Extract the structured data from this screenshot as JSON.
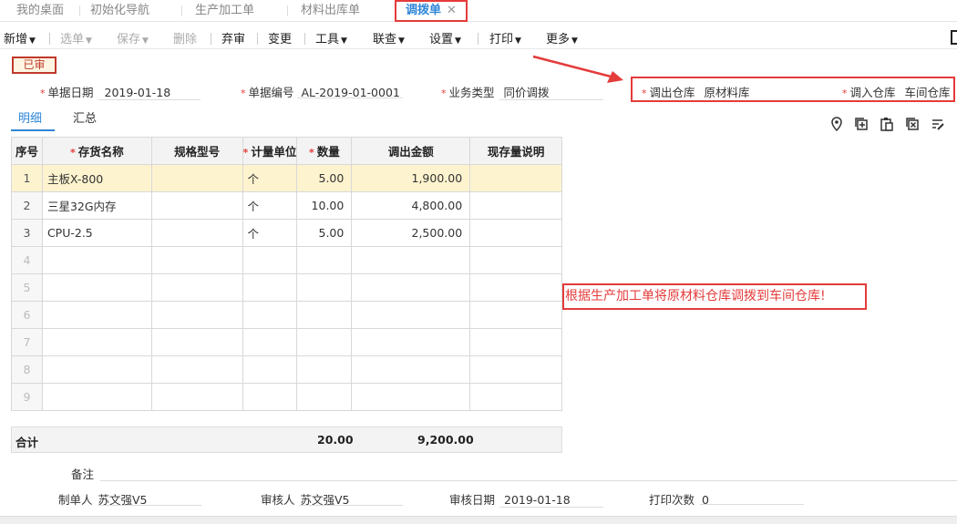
{
  "tabs": [
    "我的桌面",
    "初始化导航",
    "生产加工单",
    "材料出库单",
    "调拨单"
  ],
  "toolbar": {
    "new": "新增",
    "select": "选单",
    "save": "保存",
    "delete": "删除",
    "abandon": "弃审",
    "change": "变更",
    "tools": "工具",
    "link": "联查",
    "settings": "设置",
    "print": "打印",
    "more": "更多"
  },
  "status_stamp": "已审",
  "header": {
    "date_label": "单据日期",
    "date_value": "2019-01-18",
    "code_label": "单据编号",
    "code_value": "AL-2019-01-0001",
    "type_label": "业务类型",
    "type_value": "同价调拨",
    "out_wh_label": "调出仓库",
    "out_wh_value": "原材料库",
    "in_wh_label": "调入仓库",
    "in_wh_value": "车间仓库"
  },
  "subtabs": [
    "明细",
    "汇总"
  ],
  "icons": [
    "location-icon",
    "copy-add-icon",
    "paste-icon",
    "delete-row-icon",
    "edit-icon"
  ],
  "table": {
    "columns": [
      "序号",
      "存货名称",
      "规格型号",
      "计量单位",
      "数量",
      "调出金额",
      "现存量说明"
    ],
    "rows": [
      {
        "no": "1",
        "name": "主板X-800",
        "spec": "",
        "unit": "个",
        "qty": "5.00",
        "amount": "1,900.00",
        "note": ""
      },
      {
        "no": "2",
        "name": "三星32G内存",
        "spec": "",
        "unit": "个",
        "qty": "10.00",
        "amount": "4,800.00",
        "note": ""
      },
      {
        "no": "3",
        "name": "CPU-2.5",
        "spec": "",
        "unit": "个",
        "qty": "5.00",
        "amount": "2,500.00",
        "note": ""
      },
      {
        "no": "4"
      },
      {
        "no": "5"
      },
      {
        "no": "6"
      },
      {
        "no": "7"
      },
      {
        "no": "8"
      },
      {
        "no": "9"
      }
    ],
    "total_label": "合计",
    "total_qty": "20.00",
    "total_amount": "9,200.00"
  },
  "annotation": "根据生产加工单将原材料仓库调拨到车间仓库!",
  "footer": {
    "remark_label": "备注",
    "maker_label": "制单人",
    "maker_value": "苏文强V5",
    "auditor_label": "审核人",
    "auditor_value": "苏文强V5",
    "audit_date_label": "审核日期",
    "audit_date_value": "2019-01-18",
    "print_count_label": "打印次数",
    "print_count_value": "0"
  },
  "colors": {
    "accent": "#2f86d8",
    "highlight": "#e43b3b",
    "selected_row": "#fdf3cf"
  }
}
